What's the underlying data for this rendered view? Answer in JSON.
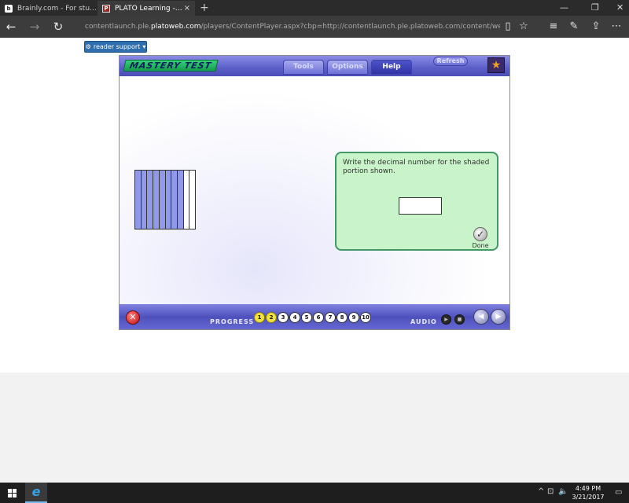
{
  "browser": {
    "tabs": [
      {
        "title": "Brainly.com - For students. By",
        "favicon": "brainly-icon",
        "favicon_glyph": "b"
      },
      {
        "title": "PLATO Learning - Conte",
        "favicon": "plato-icon",
        "favicon_glyph": "P",
        "active": true
      }
    ],
    "new_tab_glyph": "+",
    "tab_close_glyph": "×",
    "window_controls": {
      "minimize": "—",
      "restore": "❐",
      "close": "✕"
    },
    "nav": {
      "back": "←",
      "forward": "→",
      "refresh": "↻"
    },
    "url_prefix": "contentlaunch.ple.",
    "url_host": "platoweb.com",
    "url_rest": "/players/ContentPlayer.aspx?cbp=http://contentlaunch.ple.platoweb.com/content/webplato/wpmx_fun/&cwltype",
    "toolbar_glyphs": {
      "reading_view": "▯",
      "favorites": "☆",
      "hub": "≡",
      "notes": "✎",
      "share": "⇪",
      "more": "⋯"
    }
  },
  "page": {
    "reader_support": {
      "label": "reader support",
      "icon": "gear-icon",
      "glyph": "⚙",
      "caret": "▾"
    },
    "player": {
      "badge": "MASTERY TEST",
      "tabs": [
        {
          "label": "Tools",
          "active": false
        },
        {
          "label": "Options",
          "active": false
        },
        {
          "label": "Help",
          "active": true
        }
      ],
      "refresh_label": "Refresh",
      "logo_glyph": "★",
      "question": {
        "prompt": "Write the decimal number for the shaded portion shown.",
        "answer_value": "",
        "done_label": "Done",
        "done_glyph": "✓"
      },
      "model": {
        "total_strips": 10,
        "shaded_strips": 8
      },
      "footer": {
        "exit_glyph": "✕",
        "progress_label": "PROGRESS",
        "progress_items": [
          {
            "label": "1",
            "done": true
          },
          {
            "label": "2",
            "done": true
          },
          {
            "label": "3",
            "done": false
          },
          {
            "label": "4",
            "done": false
          },
          {
            "label": "5",
            "done": false
          },
          {
            "label": "6",
            "done": false
          },
          {
            "label": "7",
            "done": false
          },
          {
            "label": "8",
            "done": false
          },
          {
            "label": "9",
            "done": false
          },
          {
            "label": "10",
            "done": false
          }
        ],
        "audio_label": "AUDIO",
        "audio_play_glyph": "▶",
        "audio_stop_glyph": "■",
        "prev_glyph": "◀",
        "next_glyph": "▶"
      }
    }
  },
  "taskbar": {
    "edge_glyph": "e",
    "tray_glyphs": {
      "chevron": "^",
      "network": "⊡",
      "volume": "🔈"
    },
    "time": "4:49 PM",
    "date": "3/21/2017",
    "notification_glyph": "▭"
  }
}
